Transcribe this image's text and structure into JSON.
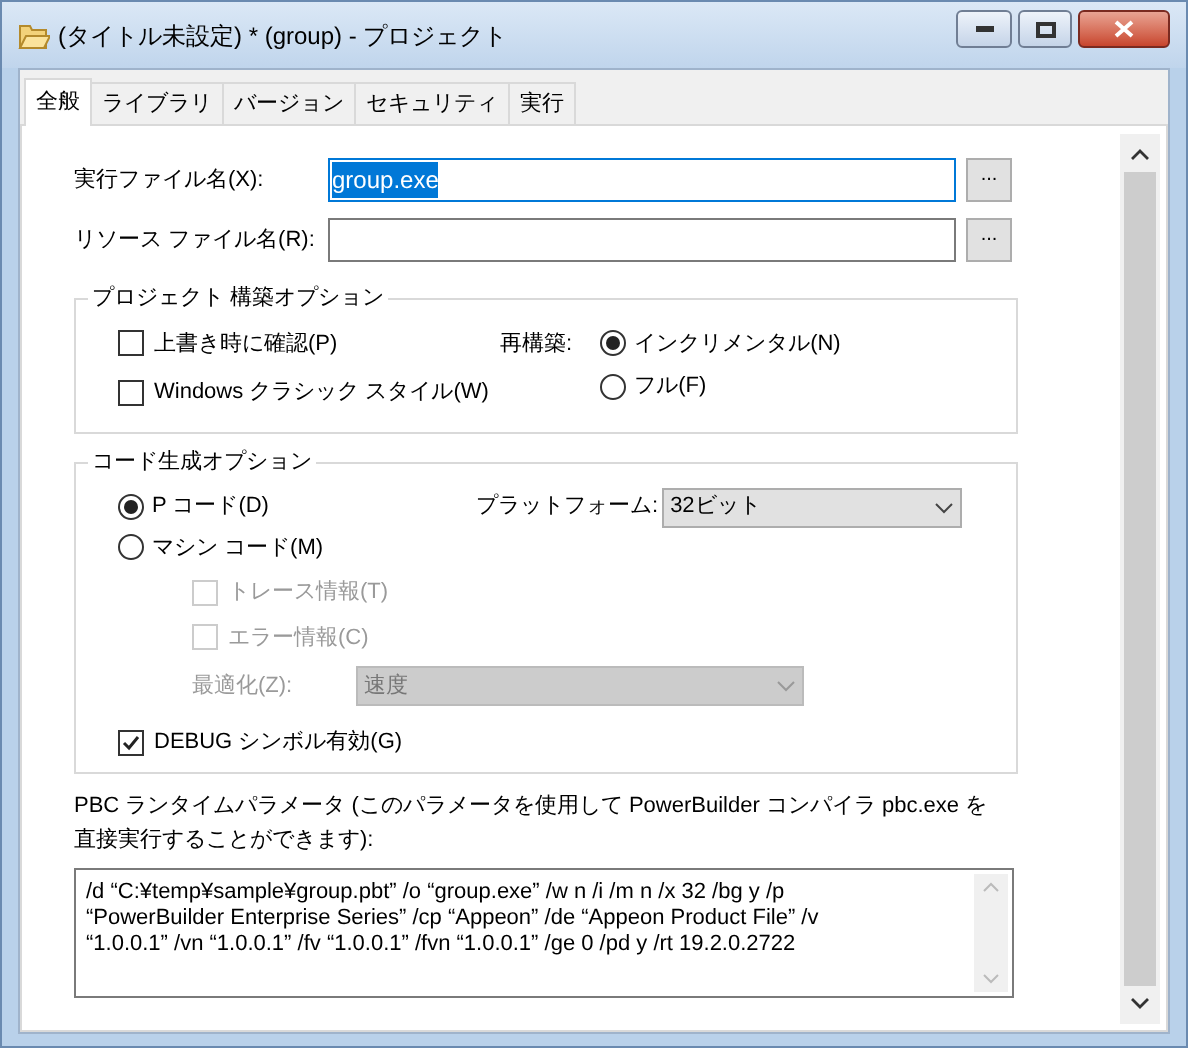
{
  "window": {
    "title": "(タイトル未設定) * (group) - プロジェクト"
  },
  "tabs": [
    {
      "label": "全般",
      "selected": true
    },
    {
      "label": "ライブラリ",
      "selected": false
    },
    {
      "label": "バージョン",
      "selected": false
    },
    {
      "label": "セキュリティ",
      "selected": false
    },
    {
      "label": "実行",
      "selected": false
    }
  ],
  "fields": [
    {
      "label": "実行ファイル名(X):",
      "value": "group.exe",
      "value_selected": true,
      "browse": "..."
    },
    {
      "label": "リソース ファイル名(R):",
      "value_selected": false,
      "browse": "..."
    }
  ],
  "build_options": {
    "legend": "プロジェクト 構築オプション",
    "checkboxes": [
      {
        "label": "上書き時に確認(P)",
        "checked": false
      },
      {
        "label": "Windows クラシック スタイル(W)",
        "checked": false
      }
    ],
    "rebuild_label": "再構築:",
    "rebuild_radios": [
      {
        "label": "インクリメンタル(N)",
        "selected": true
      },
      {
        "label": "フル(F)",
        "selected": false
      }
    ]
  },
  "codegen": {
    "legend": "コード生成オプション",
    "code_types": [
      {
        "label": "P コード(D)",
        "selected": true
      },
      {
        "label": "マシン コード(M)",
        "selected": false
      }
    ],
    "platform": {
      "label": "プラットフォーム:",
      "value": "32ビット"
    },
    "machine_checkboxes": [
      {
        "label": "トレース情報(T)",
        "checked": false,
        "disabled": true
      },
      {
        "label": "エラー情報(C)",
        "checked": false,
        "disabled": true
      }
    ],
    "optimize": {
      "label": "最適化(Z):",
      "value": "速度",
      "disabled": true
    },
    "debug": {
      "label": "DEBUG シンボル有効(G)",
      "checked": true
    }
  },
  "pbc": {
    "description": "PBC ランタイムパラメータ (このパラメータを使用して PowerBuilder コンパイラ pbc.exe を直接実行することができます):",
    "lines": [
      "/d “C:¥temp¥sample¥group.pbt” /o “group.exe” /w n /i /m n /x 32 /bg y /p",
      "“PowerBuilder Enterprise Series” /cp “Appeon” /de “Appeon Product File” /v",
      "“1.0.0.1” /vn “1.0.0.1” /fv “1.0.0.1” /fvn “1.0.0.1” /ge 0 /pd y /rt 19.2.0.2722"
    ]
  }
}
